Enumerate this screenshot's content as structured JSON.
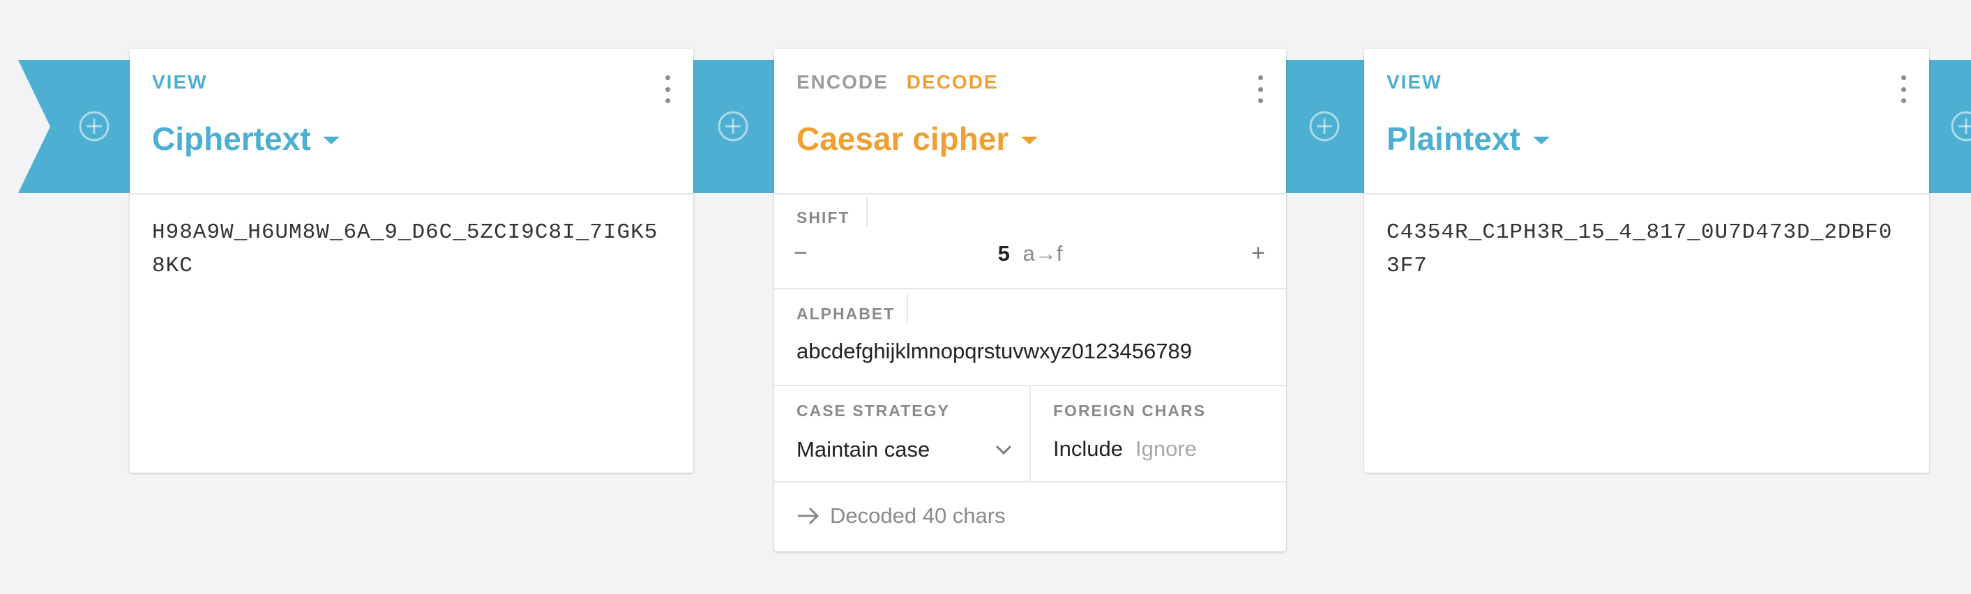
{
  "colors": {
    "accent_blue": "#4dafd2",
    "accent_orange": "#f0a032",
    "background": "#f2f3f5"
  },
  "pipeline": {
    "add_icon": "plus-circle-icon"
  },
  "cards": {
    "ciphertext": {
      "tab": "VIEW",
      "title": "Ciphertext",
      "content": "H98A9W_H6UM8W_6A_9_D6C_5ZCI9C8I_7IGK58KC",
      "menu_icon": "more-vertical-icon"
    },
    "caesar": {
      "tabs": [
        "ENCODE",
        "DECODE"
      ],
      "active_tab": "DECODE",
      "title": "Caesar cipher",
      "shift": {
        "label": "SHIFT",
        "value": "5",
        "mapping": "a→f",
        "decrement": "−",
        "increment": "+"
      },
      "alphabet": {
        "label": "ALPHABET",
        "value": "abcdefghijklmnopqrstuvwxyz0123456789"
      },
      "case_strategy": {
        "label": "CASE STRATEGY",
        "value": "Maintain case"
      },
      "foreign_chars": {
        "label": "FOREIGN CHARS",
        "options": [
          "Include",
          "Ignore"
        ],
        "selected": "Include"
      },
      "status": "Decoded 40 chars",
      "menu_icon": "more-vertical-icon"
    },
    "plaintext": {
      "tab": "VIEW",
      "title": "Plaintext",
      "content": "C4354R_C1PH3R_15_4_817_0U7D473D_2DBF03F7",
      "menu_icon": "more-vertical-icon"
    }
  }
}
